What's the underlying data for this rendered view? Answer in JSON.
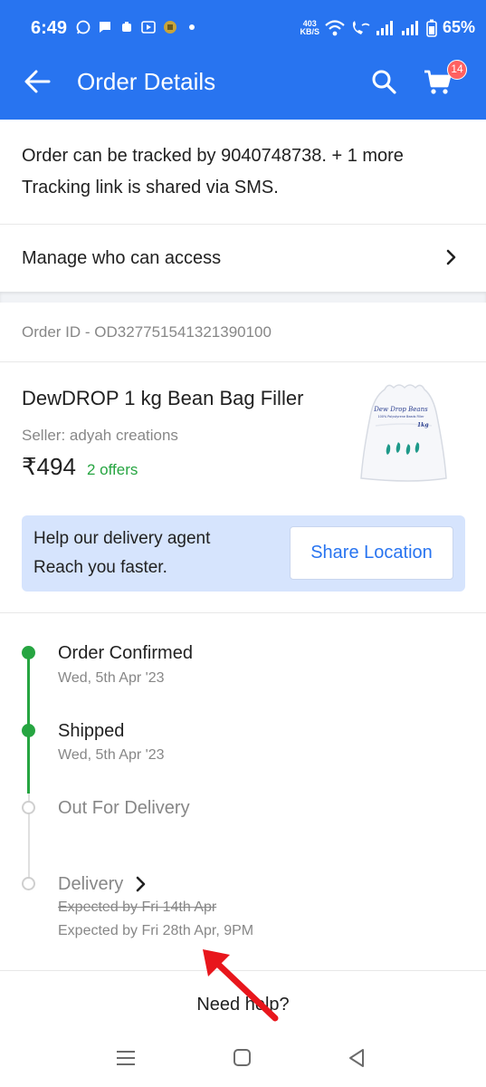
{
  "status_bar": {
    "time": "6:49",
    "net_speed_value": "403",
    "net_speed_unit": "KB/S",
    "battery": "65%",
    "icons": [
      "whatsapp-icon",
      "messages-icon",
      "notification-icon",
      "youtube-icon",
      "app-icon",
      "dot-icon",
      "wifi-icon",
      "wifi-call-icon",
      "signal-icon",
      "signal-icon",
      "battery-icon"
    ]
  },
  "app_bar": {
    "title": "Order Details",
    "cart_count": "14",
    "color": "#2874f0"
  },
  "tracking": {
    "line1": "Order can be tracked by 9040748738. + 1 more",
    "line2": "Tracking link is shared via SMS."
  },
  "manage_access": {
    "label": "Manage who can access"
  },
  "order": {
    "id_text": "Order ID - OD327751541321390100"
  },
  "product": {
    "title": "DewDROP 1 kg Bean Bag Filler",
    "seller": "Seller: adyah creations",
    "price": "₹494",
    "offers": "2 offers",
    "image_brand": "Dew Drop Beans",
    "image_tagline": "100% Polystyrene Beads Filler",
    "image_weight": "1kg"
  },
  "share_card": {
    "line1": "Help our delivery agent",
    "line2": "Reach you faster.",
    "button": "Share Location"
  },
  "timeline": [
    {
      "title": "Order Confirmed",
      "date": "Wed, 5th Apr '23",
      "status": "done"
    },
    {
      "title": "Shipped",
      "date": "Wed, 5th Apr '23",
      "status": "done"
    },
    {
      "title": "Out For Delivery",
      "status": "pending"
    },
    {
      "title": "Delivery",
      "old_expected": "Expected by Fri 14th Apr",
      "new_expected": "Expected by Fri 28th Apr, 9PM",
      "status": "pending"
    }
  ],
  "help": {
    "text": "Need help?"
  },
  "colors": {
    "primary": "#2874f0",
    "success": "#26a541",
    "badge": "#ff6161",
    "annotation_arrow": "#e8161c"
  }
}
